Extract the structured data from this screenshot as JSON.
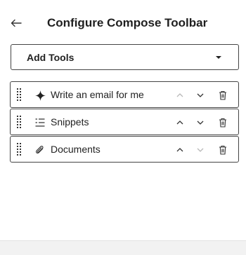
{
  "header": {
    "title": "Configure Compose Toolbar",
    "back_icon": "arrow-left-icon"
  },
  "add_tools": {
    "label": "Add Tools",
    "icon": "caret-down-icon"
  },
  "tools": [
    {
      "label": "Write an email for me",
      "icon": "sparkle-icon",
      "move_up_enabled": false,
      "move_down_enabled": true
    },
    {
      "label": "Snippets",
      "icon": "snippets-icon",
      "move_up_enabled": true,
      "move_down_enabled": true
    },
    {
      "label": "Documents",
      "icon": "paperclip-icon",
      "move_up_enabled": true,
      "move_down_enabled": false
    }
  ],
  "colors": {
    "enabled_control": "#333333",
    "disabled_control": "#b8b8b8",
    "border": "#444444"
  }
}
